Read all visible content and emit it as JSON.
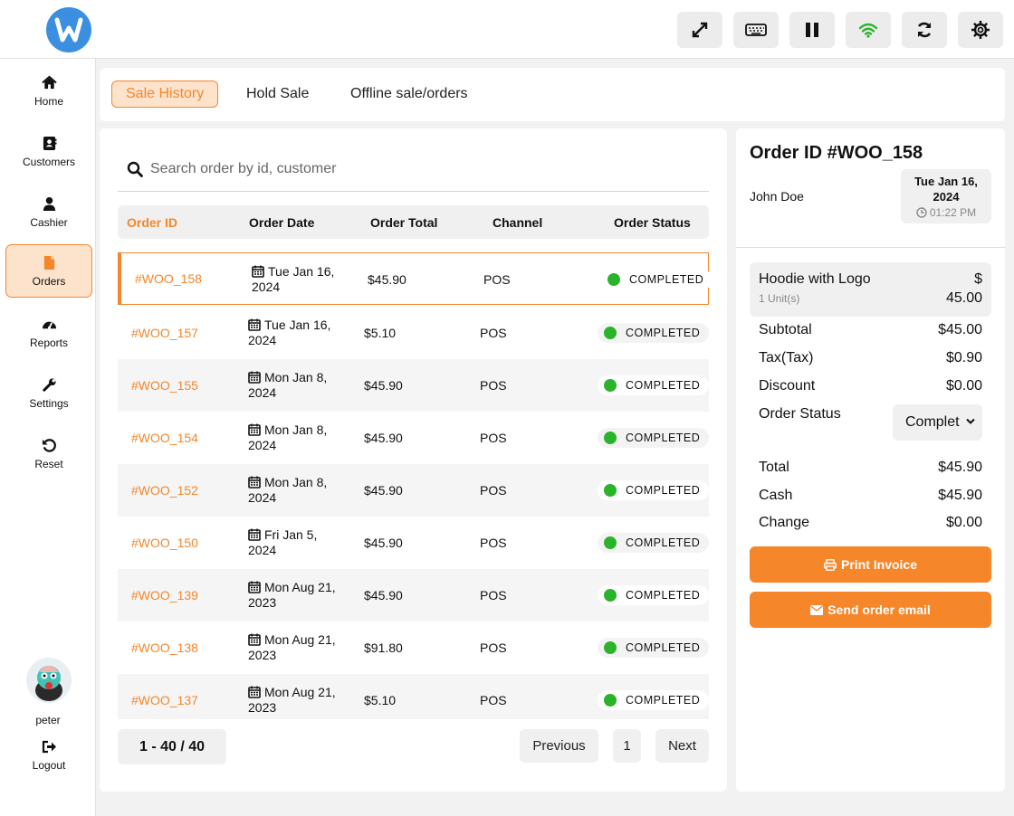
{
  "topbar": {
    "logo": "w-logo-icon",
    "buttons": [
      "expand-icon",
      "keyboard-icon",
      "pause-icon",
      "wifi-icon",
      "refresh-icon",
      "gear-icon"
    ],
    "wifi_color": "#2bb32b"
  },
  "sidebar": {
    "items": [
      {
        "label": "Home",
        "icon": "home-icon"
      },
      {
        "label": "Customers",
        "icon": "address-book-icon"
      },
      {
        "label": "Cashier",
        "icon": "user-icon"
      },
      {
        "label": "Orders",
        "icon": "file-icon",
        "active": true
      },
      {
        "label": "Reports",
        "icon": "gauge-icon"
      },
      {
        "label": "Settings",
        "icon": "wrench-icon"
      },
      {
        "label": "Reset",
        "icon": "undo-icon"
      }
    ],
    "user": "peter",
    "logout": "Logout"
  },
  "tabs": [
    "Sale History",
    "Hold Sale",
    "Offline sale/orders"
  ],
  "search": {
    "placeholder": "Search order by id, customer"
  },
  "table": {
    "headers": [
      "Order ID",
      "Order Date",
      "Order Total",
      "Channel",
      "Order Status"
    ],
    "rows": [
      {
        "id": "#WOO_158",
        "date": "Tue Jan 16, 2024",
        "total": "$45.90",
        "channel": "POS",
        "status": "COMPLETED"
      },
      {
        "id": "#WOO_157",
        "date": "Tue Jan 16, 2024",
        "total": "$5.10",
        "channel": "POS",
        "status": "COMPLETED"
      },
      {
        "id": "#WOO_155",
        "date": "Mon Jan 8, 2024",
        "total": "$45.90",
        "channel": "POS",
        "status": "COMPLETED"
      },
      {
        "id": "#WOO_154",
        "date": "Mon Jan 8, 2024",
        "total": "$45.90",
        "channel": "POS",
        "status": "COMPLETED"
      },
      {
        "id": "#WOO_152",
        "date": "Mon Jan 8, 2024",
        "total": "$45.90",
        "channel": "POS",
        "status": "COMPLETED"
      },
      {
        "id": "#WOO_150",
        "date": "Fri Jan 5, 2024",
        "total": "$45.90",
        "channel": "POS",
        "status": "COMPLETED"
      },
      {
        "id": "#WOO_139",
        "date": "Mon Aug 21, 2023",
        "total": "$45.90",
        "channel": "POS",
        "status": "COMPLETED"
      },
      {
        "id": "#WOO_138",
        "date": "Mon Aug 21, 2023",
        "total": "$91.80",
        "channel": "POS",
        "status": "COMPLETED"
      },
      {
        "id": "#WOO_137",
        "date": "Mon Aug 21, 2023",
        "total": "$5.10",
        "channel": "POS",
        "status": "COMPLETED"
      }
    ]
  },
  "pagination": {
    "count": "1 - 40 / 40",
    "previous": "Previous",
    "page": "1",
    "next": "Next"
  },
  "detail": {
    "title": "Order ID #WOO_158",
    "customer": "John Doe",
    "date_line1": "Tue Jan 16,",
    "date_line2": "2024",
    "time": "01:22 PM",
    "item": {
      "name": "Hoodie with Logo",
      "qty": "1 Unit(s)",
      "currency": "$",
      "price": "45.00"
    },
    "subtotal_label": "Subtotal",
    "subtotal": "$45.00",
    "tax_label": "Tax(Tax)",
    "tax": "$0.90",
    "discount_label": "Discount",
    "discount": "$0.00",
    "status_label": "Order Status",
    "status_value": "Complet",
    "total_label": "Total",
    "total": "$45.90",
    "cash_label": "Cash",
    "cash": "$45.90",
    "change_label": "Change",
    "change": "$0.00",
    "print_label": "Print Invoice",
    "email_label": "Send order email"
  },
  "colors": {
    "accent": "#f5862a",
    "status_green": "#2bb32b",
    "logo_blue": "#3b8fe0"
  }
}
